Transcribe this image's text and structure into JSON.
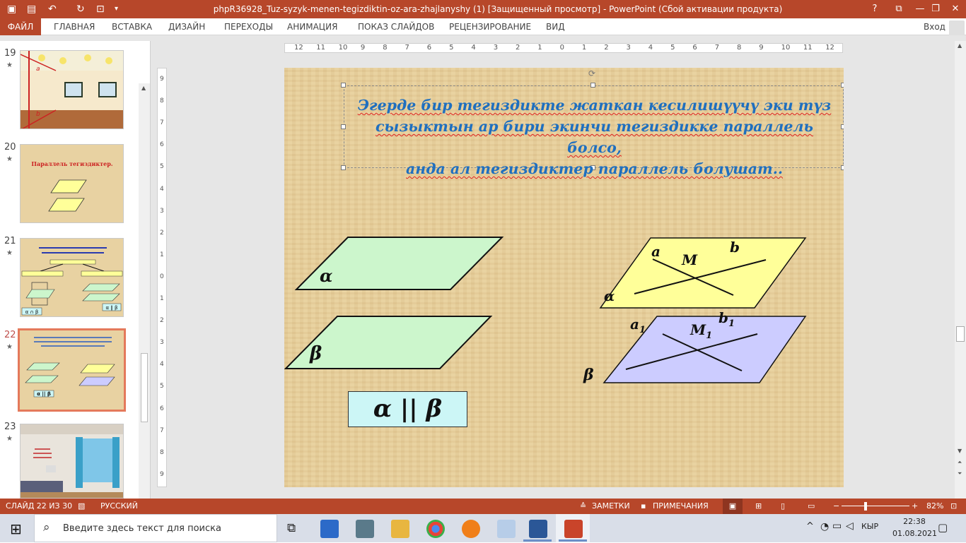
{
  "window": {
    "title": "phpR36928_Tuz-syzyk-menen-tegizdiktin-oz-ara-zhajlanyshy (1) [Защищенный просмотр] -  PowerPoint (Сбой активации продукта)",
    "help": "?",
    "restore_ribbon": "⧉",
    "minimize": "—",
    "maximize": "❐",
    "close": "✕"
  },
  "ribbon": {
    "file": "ФАЙЛ",
    "tabs": [
      "ГЛАВНАЯ",
      "ВСТАВКА",
      "ДИЗАЙН",
      "ПЕРЕХОДЫ",
      "АНИМАЦИЯ",
      "ПОКАЗ СЛАЙДОВ",
      "РЕЦЕНЗИРОВАНИЕ",
      "ВИД"
    ],
    "login": "Вход"
  },
  "thumbnails": [
    {
      "num": "19",
      "star": "★",
      "labels": [
        "a",
        "b"
      ]
    },
    {
      "num": "20",
      "star": "★",
      "title": "Параллель тегиздиктер."
    },
    {
      "num": "21",
      "star": "★",
      "label": "α ∥ β",
      "label2": "α ∩ β"
    },
    {
      "num": "22",
      "star": "★",
      "label": "α || β"
    },
    {
      "num": "23",
      "star": "★"
    }
  ],
  "ruler": {
    "h_ticks": [
      "12",
      "11",
      "10",
      "9",
      "8",
      "7",
      "6",
      "5",
      "4",
      "3",
      "2",
      "1",
      "0",
      "1",
      "2",
      "3",
      "4",
      "5",
      "6",
      "7",
      "8",
      "9",
      "10",
      "11",
      "12"
    ],
    "v_ticks": [
      "9",
      "8",
      "7",
      "6",
      "5",
      "4",
      "3",
      "2",
      "1",
      "0",
      "1",
      "2",
      "3",
      "4",
      "5",
      "6",
      "7",
      "8",
      "9"
    ]
  },
  "slide": {
    "text_line1": "Эгерде бир тегиздикте жаткан кесилишүүчү эки түз",
    "text_line2": "сызыктын ар бири экинчи тегиздикке параллель болсо,",
    "text_line3": "анда ал тегиздиктер параллель болушат..",
    "alpha": "α",
    "beta": "β",
    "parallel": "α || β",
    "label_a": "a",
    "label_b": "b",
    "label_M": "M",
    "label_a1": "a",
    "label_b1": "b",
    "label_M1": "M",
    "sub1": "1",
    "colors": {
      "green_plane": "#ccf6cc",
      "yellow_plane": "#ffff99",
      "purple_plane": "#ccccff",
      "text_blue": "#1f6fbf"
    }
  },
  "status": {
    "slide": "СЛАЙД 22 ИЗ 30",
    "language": "РУССКИЙ",
    "notes": "ЗАМЕТКИ",
    "comments": "ПРИМЕЧАНИЯ",
    "zoom": "82%",
    "zoom_minus": "−",
    "zoom_plus": "+"
  },
  "taskbar": {
    "search_placeholder": "Введите здесь текст для поиска",
    "language": "КЫР",
    "time": "22:38",
    "date": "01.08.2021",
    "caret": "^"
  }
}
